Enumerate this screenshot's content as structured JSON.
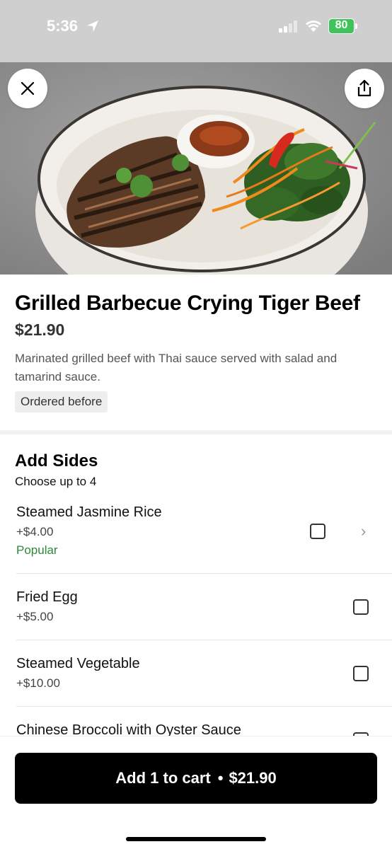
{
  "status_bar": {
    "time": "5:36",
    "battery": "80"
  },
  "item": {
    "title": "Grilled Barbecue Crying Tiger Beef",
    "price": "$21.90",
    "description": "Marinated grilled beef with Thai sauce served with salad and tamarind sauce.",
    "badge": "Ordered before"
  },
  "sides": {
    "title": "Add Sides",
    "subtitle": "Choose up to 4",
    "options": [
      {
        "name": "Steamed Jasmine Rice",
        "price": "+$4.00",
        "badge": "Popular",
        "checked": false
      },
      {
        "name": "Fried Egg",
        "price": "+$5.00",
        "checked": false
      },
      {
        "name": "Steamed Vegetable",
        "price": "+$10.00",
        "checked": false
      },
      {
        "name": "Chinese Broccoli with Oyster Sauce",
        "checked": false
      }
    ]
  },
  "cart": {
    "label": "Add 1 to cart",
    "separator": "•",
    "total": "$21.90"
  },
  "icons": {
    "close": "close-icon",
    "share": "share-icon",
    "location": "location-arrow-icon",
    "chevron": "chevron-right-icon"
  },
  "colors": {
    "accent_green": "#2c8a38",
    "button_bg": "#000000",
    "battery": "#3fc35a"
  }
}
